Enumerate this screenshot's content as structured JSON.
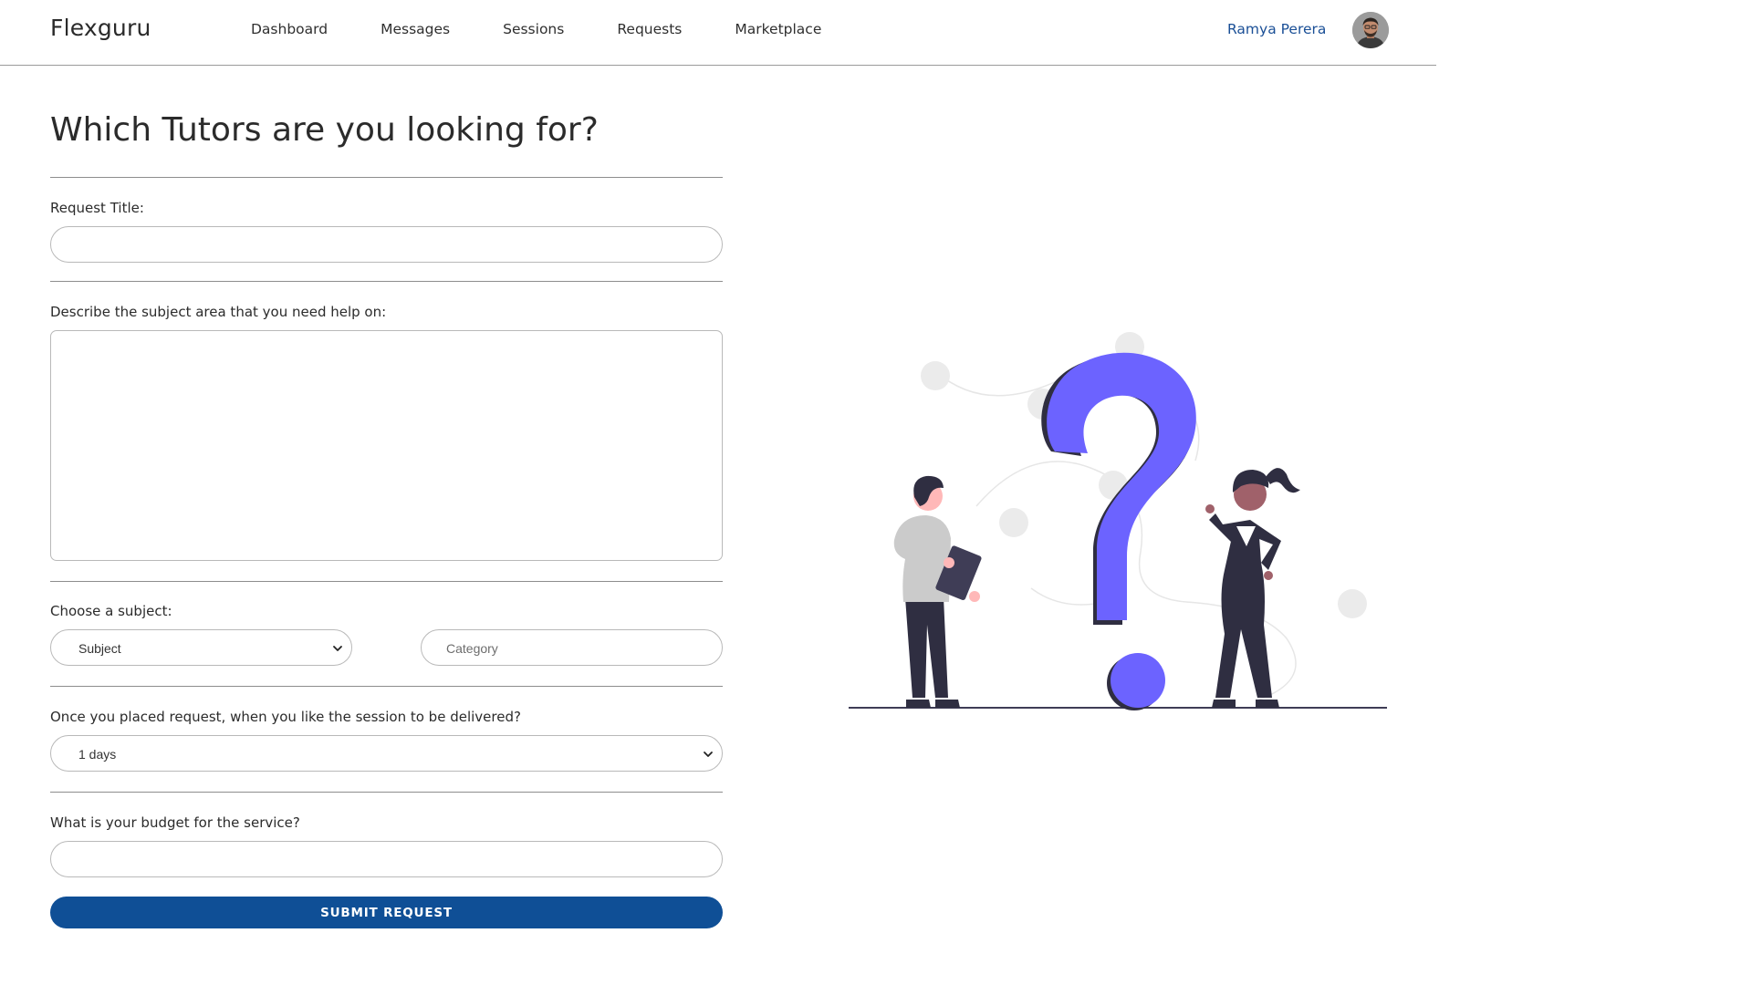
{
  "header": {
    "brand": "Flexguru",
    "nav": [
      "Dashboard",
      "Messages",
      "Sessions",
      "Requests",
      "Marketplace"
    ],
    "user_name": "Ramya Perera"
  },
  "form": {
    "title": "Which Tutors are you looking for?",
    "request_title_label": "Request Title:",
    "request_title_value": "",
    "description_label": "Describe the subject area that you need help on:",
    "description_value": "",
    "subject_label": "Choose a subject:",
    "subject_select_value": "Subject",
    "category_placeholder": "Category",
    "delivery_label": "Once you placed request, when you like the session to be delivered?",
    "delivery_select_value": "1 days",
    "budget_label": "What is your budget for the service?",
    "budget_value": "",
    "submit_label": "SUBMIT REQUEST"
  },
  "colors": {
    "accent": "#0f4f96",
    "illustration_purple": "#6c63ff",
    "illustration_dark": "#2f2e41"
  },
  "icons": {
    "select_chevron": "chevron-down-icon",
    "illustration": "question-mark-people-illustration"
  }
}
